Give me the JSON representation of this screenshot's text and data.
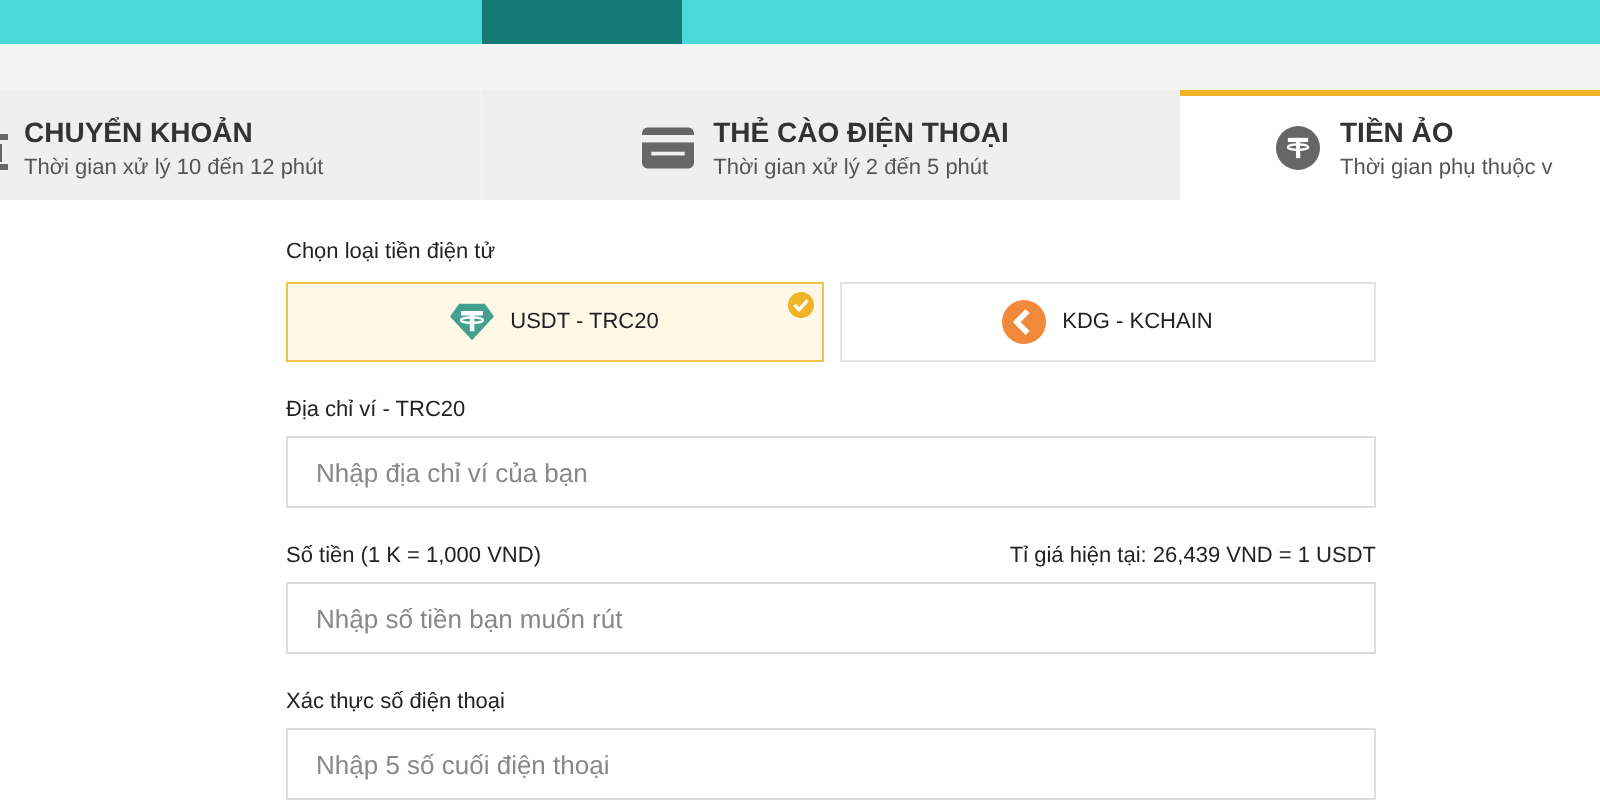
{
  "top_nav": {
    "items": [
      {
        "selected": false
      },
      {
        "selected": true
      },
      {
        "selected": false
      }
    ]
  },
  "tabs": [
    {
      "kind": "bank",
      "label": "CHUYỂN KHOẢN",
      "subtitle": "Thời gian xử lý 10 đến 12 phút",
      "selected": false
    },
    {
      "kind": "card",
      "label": "THẺ CÀO ĐIỆN THOẠI",
      "subtitle": "Thời gian xử lý 2 đến 5 phút",
      "selected": false
    },
    {
      "kind": "crypto",
      "label": "TIỀN ẢO",
      "subtitle": "Thời gian phụ thuộc v",
      "selected": true
    }
  ],
  "currency": {
    "label": "Chọn loại tiền điện tử",
    "options": [
      {
        "kind": "usdt",
        "label": "USDT - TRC20",
        "selected": true
      },
      {
        "kind": "kdg",
        "label": "KDG - KCHAIN",
        "selected": false
      }
    ]
  },
  "fields": [
    {
      "label": "Địa chỉ ví - TRC20",
      "placeholder": "Nhập địa chỉ ví của bạn"
    },
    {
      "label": "Số tiền (1 K = 1,000 VND)",
      "note": "Tỉ giá hiện tại: 26,439 VND = 1 USDT",
      "placeholder": "Nhập số tiền bạn muốn rút"
    },
    {
      "label": "Xác thực số điện thoại",
      "placeholder": "Nhập 5 số cuối điện thoại"
    }
  ]
}
